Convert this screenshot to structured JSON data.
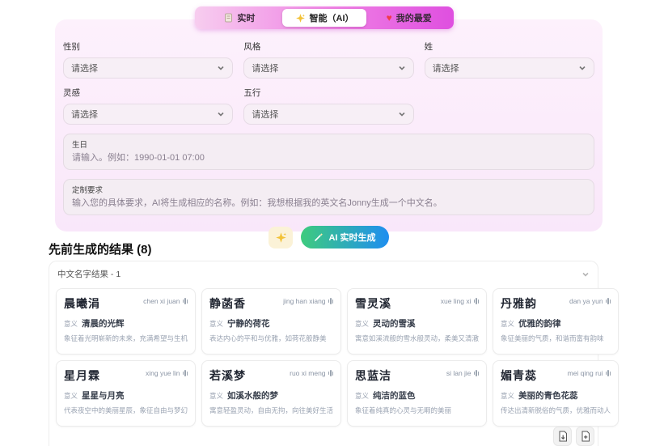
{
  "tabs": {
    "realtime": "实时",
    "ai": "智能（AI）",
    "favorites": "我的最爱",
    "heart_glyph": "♥"
  },
  "form": {
    "fields": [
      {
        "label": "性别",
        "placeholder": "请选择"
      },
      {
        "label": "风格",
        "placeholder": "请选择"
      },
      {
        "label": "姓",
        "placeholder": "请选择"
      },
      {
        "label": "灵感",
        "placeholder": "请选择"
      },
      {
        "label": "五行",
        "placeholder": "请选择"
      }
    ],
    "birthday": {
      "label": "生日",
      "placeholder": "请输入。例如：1990-01-01 07:00"
    },
    "requirements": {
      "label": "定制要求",
      "placeholder": "输入您的具体要求，AI将生成相应的名称。例如：我想根据我的英文名Jonny生成一个中文名。"
    },
    "generate_label": "AI 实时生成"
  },
  "results": {
    "heading": "先前生成的结果 (8)",
    "group_label": "中文名字结果 - 1",
    "meaning_label": "意义",
    "cards": [
      {
        "name": "晨曦涓",
        "pinyin": "chen xi juan",
        "meaning": "清晨的光辉",
        "description": "象征着光明崭新的未来，充满希望与生机"
      },
      {
        "name": "静菡香",
        "pinyin": "jing han xiang",
        "meaning": "宁静的荷花",
        "description": "表达内心的平和与优雅，如荷花般静美"
      },
      {
        "name": "雪灵溪",
        "pinyin": "xue ling xi",
        "meaning": "灵动的雪溪",
        "description": "寓意如溪流般的雪水般灵动，柔美又清澈"
      },
      {
        "name": "丹雅韵",
        "pinyin": "dan ya yun",
        "meaning": "优雅的韵律",
        "description": "象征美丽的气质，和谐而富有韵味"
      },
      {
        "name": "星月霖",
        "pinyin": "xing yue lin",
        "meaning": "星星与月亮",
        "description": "代表夜空中的美丽星辰，象征自由与梦幻"
      },
      {
        "name": "若溪梦",
        "pinyin": "ruo xi meng",
        "meaning": "如溪水般的梦",
        "description": "寓意轻盈灵动，自由无拘，向往美好生活"
      },
      {
        "name": "思蓝洁",
        "pinyin": "si lan jie",
        "meaning": "纯洁的蓝色",
        "description": "象征着纯真的心灵与无暇的美丽"
      },
      {
        "name": "媚青蕊",
        "pinyin": "mei qing rui",
        "meaning": "美丽的青色花蕊",
        "description": "传达出清新脱俗的气质，优雅而动人"
      }
    ]
  },
  "colors": {
    "tabbar_gradient_start": "#f7cdef",
    "tabbar_gradient_end": "#df4fe0",
    "panel_background": "#fbecfb",
    "generate_gradient_start": "#3ecb7e",
    "generate_gradient_end": "#1f8ef0",
    "heart_red": "#ef3b4a",
    "sparkle_gold": "#f2c238"
  }
}
